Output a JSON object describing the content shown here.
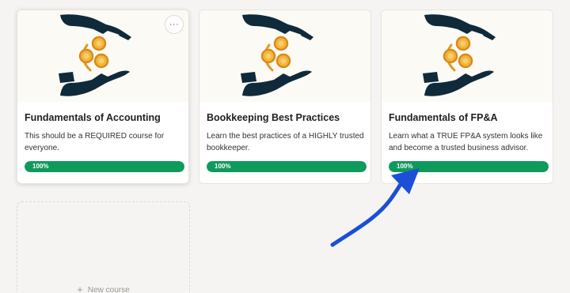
{
  "courses": [
    {
      "title": "Fundamentals of Accounting",
      "description": "This should be a REQUIRED course for everyone.",
      "progress_label": "100%",
      "progress": 1.0,
      "thumbnail_icon": "hands-coins-icon",
      "has_menu": true
    },
    {
      "title": "Bookkeeping Best Practices",
      "description": "Learn the best practices of a HIGHLY trusted bookkeeper.",
      "progress_label": "100%",
      "progress": 1.0,
      "thumbnail_icon": "hands-coins-icon",
      "has_menu": false
    },
    {
      "title": "Fundamentals of FP&A",
      "description": "Learn what a TRUE FP&A system looks like and become a trusted business advisor.",
      "progress_label": "100%",
      "progress": 1.0,
      "thumbnail_icon": "hands-coins-icon",
      "has_menu": false
    }
  ],
  "card_menu": {
    "icon": "more-options-icon",
    "label": "···"
  },
  "new_course": {
    "icon": "plus-icon",
    "plus_glyph": "+",
    "label": "New course"
  },
  "annotation": {
    "icon": "blue-arrow-annotation"
  },
  "colors": {
    "progress_fill": "#0f9a5d",
    "hands": "#0f2a3a",
    "coin": "#f2b640",
    "coin_ring": "#d98b1a",
    "arrow": "#1b4fd8",
    "background": "#f5f4f2"
  }
}
